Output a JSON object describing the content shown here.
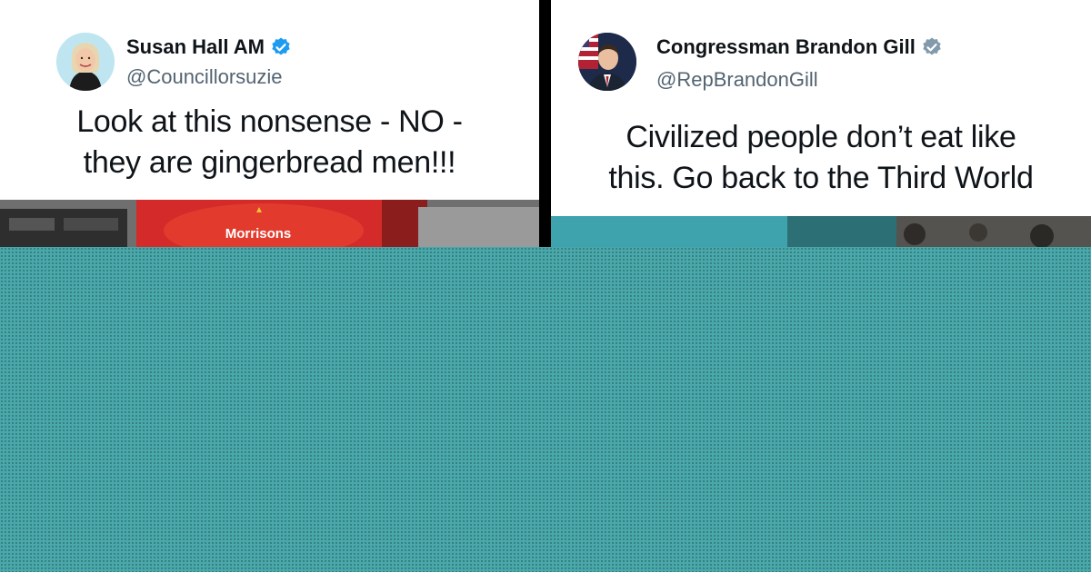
{
  "tweets": [
    {
      "display_name": "Susan Hall AM",
      "handle": "@Councillorsuzie",
      "verified_badge_color": "#1d9bf0",
      "text_line1": "Look at this nonsense - NO -",
      "text_line2": "they are gingerbread men!!!",
      "photo_label": "Morrisons"
    },
    {
      "display_name": "Congressman Brandon Gill",
      "handle": "@RepBrandonGill",
      "verified_badge_color": "#829aab",
      "text_line1": "Civilized people don’t eat like",
      "text_line2": "this. Go back to the Third World"
    }
  ],
  "colors": {
    "divider": "#000000",
    "overlay": "#4aa8aa",
    "text": "#0f1419",
    "handle": "#536471"
  }
}
